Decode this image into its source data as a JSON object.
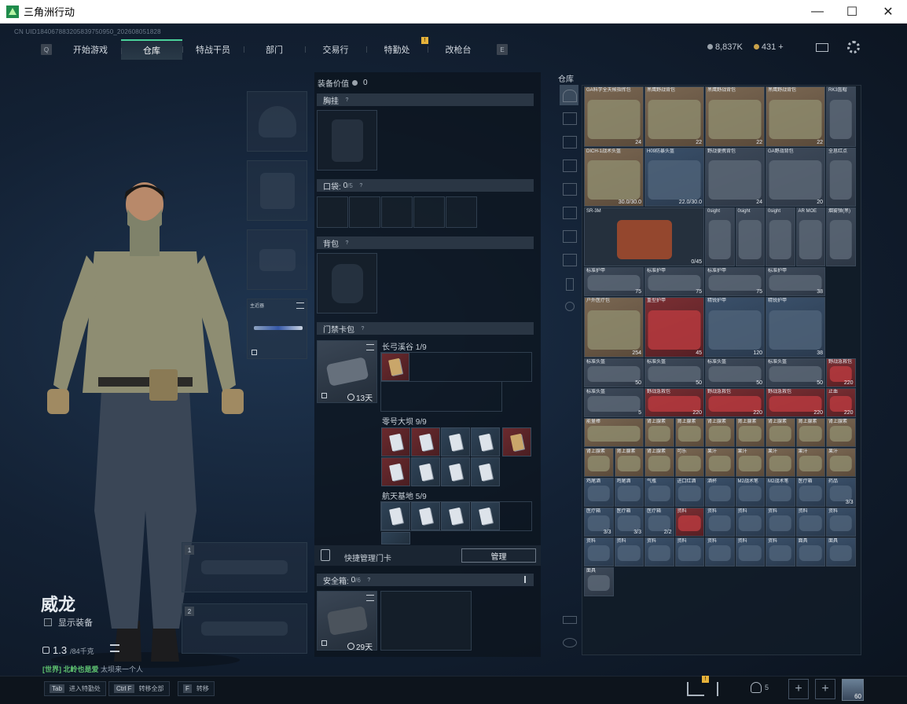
{
  "window": {
    "title": "三角洲行动"
  },
  "uid_text": "CN UID184067883205839750950_202608051828",
  "nav": {
    "key_left": "Q",
    "key_right": "E",
    "tabs": [
      "开始游戏",
      "仓库",
      "特战干员",
      "部门",
      "交易行",
      "特勤处",
      "改枪台"
    ],
    "active_tab": 1,
    "badge": "!"
  },
  "currency": {
    "silver": "8,837K",
    "gold": "431",
    "gold_plus": "+"
  },
  "character": {
    "name": "威龙",
    "show_equipment_label": "显示装备",
    "weight_current": "1.3",
    "weight_max": "/84千克",
    "chat_channel": "[世界]",
    "chat_user": "北岭也是爱",
    "chat_message": "太坝来一个人"
  },
  "melee_slot": {
    "label": "主近器"
  },
  "weapon_slots": [
    "1",
    "2"
  ],
  "equipment": {
    "value_label": "装备价值",
    "value": "0",
    "chest_rig": "胸挂",
    "pockets_label": "口袋:",
    "pockets_count": "0",
    "pockets_max": "/5",
    "backpack": "背包",
    "keycard_bag": "门禁卡包",
    "keycard_days": "13天",
    "card_sets": [
      {
        "name": "长弓溪谷",
        "count": "1/9"
      },
      {
        "name": "零号大坝",
        "count": "9/9"
      },
      {
        "name": "航天基地",
        "count": "5/9"
      }
    ],
    "quick_manage": "快捷管理门卡",
    "manage_button": "管理",
    "safe_box_label": "安全箱:",
    "safe_box_count": "0",
    "safe_box_max": "/6",
    "safe_box_days": "29天"
  },
  "warehouse": {
    "title": "仓库",
    "rows": [
      [
        {
          "l": "GA科学全天候指挥包",
          "c": "24",
          "k": "brown",
          "w": 2
        },
        {
          "l": "黑鹰野战背包",
          "c": "22",
          "k": "brown",
          "w": 2
        },
        {
          "l": "黑鹰野战背包",
          "c": "22",
          "k": "brown",
          "w": 2
        },
        {
          "l": "黑鹰野战背包",
          "c": "22",
          "k": "brown",
          "w": 2
        },
        {
          "l": "RK3盔帽",
          "c": "",
          "k": "gray",
          "w": 1
        }
      ],
      [
        {
          "l": "DICH-1战术头盔",
          "c": "30.0/30.0",
          "k": "brown",
          "w": 2
        },
        {
          "l": "H09防暴头盔",
          "c": "22.0/30.0",
          "k": "blue",
          "w": 2
        },
        {
          "l": "野战便携背包",
          "c": "24",
          "k": "gray",
          "w": 2
        },
        {
          "l": "GA野战背包",
          "c": "20",
          "k": "gray",
          "w": 2
        },
        {
          "l": "全息红点",
          "c": "",
          "k": "gray",
          "w": 1
        }
      ],
      [
        {
          "l": "SR-3M",
          "c": "0/45",
          "k": "dark",
          "w": 4
        },
        {
          "l": "0sight",
          "c": "",
          "k": "gray",
          "w": 1
        },
        {
          "l": "0sight",
          "c": "",
          "k": "gray",
          "w": 1
        },
        {
          "l": "0sight",
          "c": "",
          "k": "gray",
          "w": 1
        },
        {
          "l": "AR MOE",
          "c": "",
          "k": "gray",
          "w": 1
        },
        {
          "l": "烟雾弹(黑)",
          "c": "",
          "k": "gray",
          "w": 1
        }
      ],
      [
        {
          "l": "标准护甲",
          "c": "75",
          "k": "gray",
          "w": 2
        },
        {
          "l": "标准护甲",
          "c": "75",
          "k": "gray",
          "w": 2
        },
        {
          "l": "标准护甲",
          "c": "75",
          "k": "gray",
          "w": 2
        },
        {
          "l": "标准护甲",
          "c": "38",
          "k": "gray",
          "w": 2
        }
      ],
      [
        {
          "l": "户外医疗包",
          "c": "254",
          "k": "brown",
          "w": 2
        },
        {
          "l": "重型护甲",
          "c": "45",
          "k": "red",
          "w": 2
        },
        {
          "l": "精锐护甲",
          "c": "120",
          "k": "blue",
          "w": 2
        },
        {
          "l": "精锐护甲",
          "c": "38",
          "k": "blue",
          "w": 2
        }
      ],
      [
        {
          "l": "标准头盔",
          "c": "50",
          "k": "gray",
          "w": 2
        },
        {
          "l": "标准头盔",
          "c": "50",
          "k": "gray",
          "w": 2
        },
        {
          "l": "标准头盔",
          "c": "50",
          "k": "gray",
          "w": 2
        },
        {
          "l": "标准头盔",
          "c": "50",
          "k": "gray",
          "w": 2
        },
        {
          "l": "野战急救包",
          "c": "220",
          "k": "red",
          "w": 1
        }
      ],
      [
        {
          "l": "标准头盔",
          "c": "5",
          "k": "gray",
          "w": 2
        },
        {
          "l": "野战急救包",
          "c": "220",
          "k": "red",
          "w": 2
        },
        {
          "l": "野战急救包",
          "c": "220",
          "k": "red",
          "w": 2
        },
        {
          "l": "野战急救包",
          "c": "220",
          "k": "red",
          "w": 2
        },
        {
          "l": "止血",
          "c": "220",
          "k": "red",
          "w": 1
        }
      ],
      [
        {
          "l": "能量棒",
          "c": "",
          "k": "brown",
          "w": 2
        },
        {
          "l": "肾上腺素",
          "c": "",
          "k": "brown",
          "w": 1
        },
        {
          "l": "肾上腺素",
          "c": "",
          "k": "brown",
          "w": 1
        },
        {
          "l": "肾上腺素",
          "c": "",
          "k": "brown",
          "w": 1
        },
        {
          "l": "肾上腺素",
          "c": "",
          "k": "brown",
          "w": 1
        },
        {
          "l": "肾上腺素",
          "c": "",
          "k": "brown",
          "w": 1
        },
        {
          "l": "肾上腺素",
          "c": "",
          "k": "brown",
          "w": 1
        },
        {
          "l": "肾上腺素",
          "c": "",
          "k": "brown",
          "w": 1
        }
      ],
      [
        {
          "l": "肾上腺素",
          "c": "",
          "k": "brown",
          "w": 1
        },
        {
          "l": "肾上腺素",
          "c": "",
          "k": "brown",
          "w": 1
        },
        {
          "l": "肾上腺素",
          "c": "",
          "k": "brown",
          "w": 1
        },
        {
          "l": "可乐",
          "c": "",
          "k": "brown",
          "w": 1
        },
        {
          "l": "果汁",
          "c": "",
          "k": "brown",
          "w": 1
        },
        {
          "l": "果汁",
          "c": "",
          "k": "brown",
          "w": 1
        },
        {
          "l": "果汁",
          "c": "",
          "k": "brown",
          "w": 1
        },
        {
          "l": "果汁",
          "c": "",
          "k": "brown",
          "w": 1
        },
        {
          "l": "果汁",
          "c": "",
          "k": "brown",
          "w": 1
        }
      ],
      [
        {
          "l": "鸡尾酒",
          "c": "",
          "k": "blue",
          "w": 1
        },
        {
          "l": "鸡尾酒",
          "c": "",
          "k": "blue",
          "w": 1
        },
        {
          "l": "气瓶",
          "c": "",
          "k": "blue",
          "w": 1
        },
        {
          "l": "进口红酒",
          "c": "",
          "k": "blue",
          "w": 1
        },
        {
          "l": "酒杯",
          "c": "",
          "k": "blue",
          "w": 1
        },
        {
          "l": "M2战术笔",
          "c": "",
          "k": "blue",
          "w": 1
        },
        {
          "l": "M2战术笔",
          "c": "",
          "k": "blue",
          "w": 1
        },
        {
          "l": "医疗箱",
          "c": "",
          "k": "blue",
          "w": 1
        },
        {
          "l": "药品",
          "c": "3/3",
          "k": "blue",
          "w": 1
        }
      ],
      [
        {
          "l": "医疗箱",
          "c": "3/3",
          "k": "blue",
          "w": 1
        },
        {
          "l": "医疗箱",
          "c": "3/3",
          "k": "blue",
          "w": 1
        },
        {
          "l": "医疗箱",
          "c": "2/2",
          "k": "blue",
          "w": 1
        },
        {
          "l": "资料",
          "c": "",
          "k": "red",
          "w": 1
        },
        {
          "l": "资料",
          "c": "",
          "k": "blue",
          "w": 1
        },
        {
          "l": "资料",
          "c": "",
          "k": "blue",
          "w": 1
        },
        {
          "l": "资料",
          "c": "",
          "k": "blue",
          "w": 1
        },
        {
          "l": "资料",
          "c": "",
          "k": "blue",
          "w": 1
        },
        {
          "l": "资料",
          "c": "",
          "k": "blue",
          "w": 1
        }
      ],
      [
        {
          "l": "资料",
          "c": "",
          "k": "blue",
          "w": 1
        },
        {
          "l": "资料",
          "c": "",
          "k": "blue",
          "w": 1
        },
        {
          "l": "资料",
          "c": "",
          "k": "blue",
          "w": 1
        },
        {
          "l": "资料",
          "c": "",
          "k": "blue",
          "w": 1
        },
        {
          "l": "资料",
          "c": "",
          "k": "blue",
          "w": 1
        },
        {
          "l": "资料",
          "c": "",
          "k": "blue",
          "w": 1
        },
        {
          "l": "资料",
          "c": "",
          "k": "blue",
          "w": 1
        },
        {
          "l": "面具",
          "c": "",
          "k": "blue",
          "w": 1
        },
        {
          "l": "面具",
          "c": "",
          "k": "blue",
          "w": 1
        }
      ],
      [
        {
          "l": "面具",
          "c": "",
          "k": "gray",
          "w": 1
        }
      ]
    ]
  },
  "bottombar": {
    "hotkeys": [
      {
        "key": "Tab",
        "label": "进入特勤处"
      },
      {
        "key": "Ctrl F",
        "label": "转移全部"
      },
      {
        "key": "F",
        "label": "转移"
      }
    ],
    "squad_count": "5",
    "badge": "!",
    "player_level": "60"
  },
  "colors": {
    "accent": "#4ad19a",
    "badge": "#e6b23a",
    "panel": "#121c28"
  }
}
